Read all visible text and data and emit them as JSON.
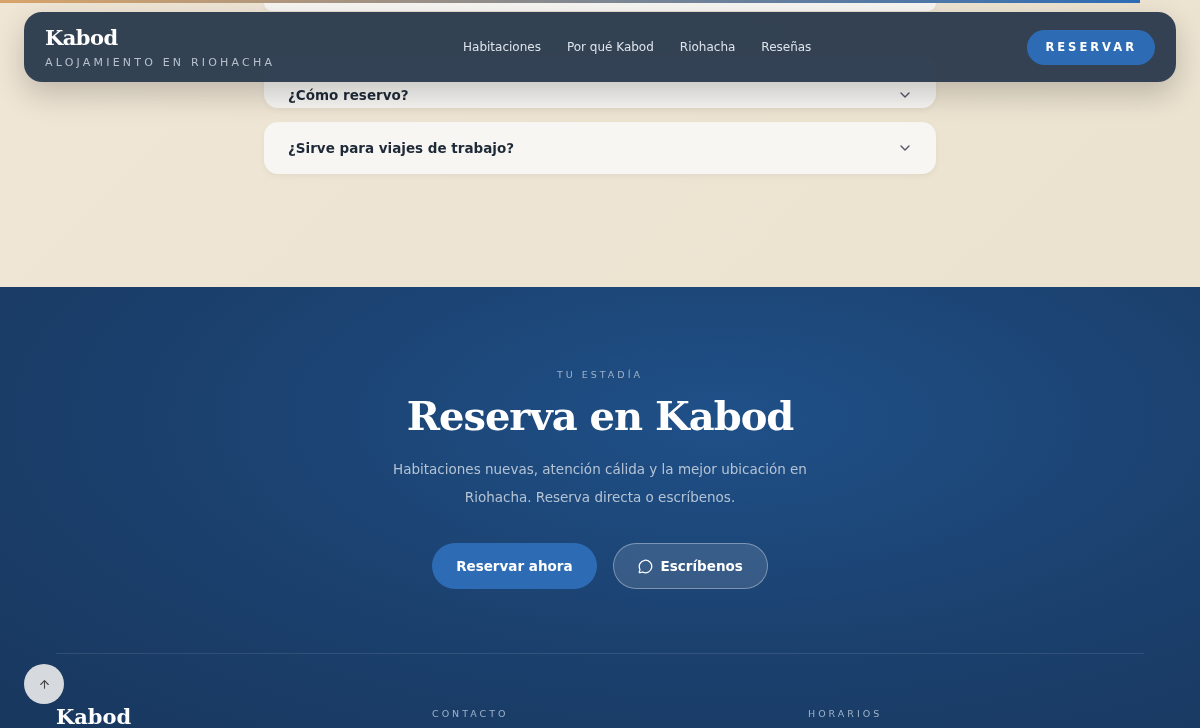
{
  "progress": {
    "level": 0.95
  },
  "navbar": {
    "brand": "Kabod",
    "tagline": "ALOJAMIENTO EN RIOHACHA",
    "links": [
      "Habitaciones",
      "Por qué Kabod",
      "Riohacha",
      "Reseñas"
    ],
    "cta": "RESERVAR"
  },
  "faq": [
    {
      "question": "¿Cómo reservo?",
      "expanded": false
    },
    {
      "question": "¿Sirve para viajes de trabajo?",
      "expanded": false
    }
  ],
  "booking": {
    "eyebrow": "TU ESTADÍA",
    "title": "Reserva en Kabod",
    "text": "Habitaciones nuevas, atención cálida y la mejor ubicación en Riohacha. Reserva directa o escríbenos.",
    "primary": "Reservar ahora",
    "secondary": "Escríbenos"
  },
  "footer": {
    "brand": "Kabod",
    "columns": [
      "CONTACTO",
      "HORARIOS"
    ]
  }
}
